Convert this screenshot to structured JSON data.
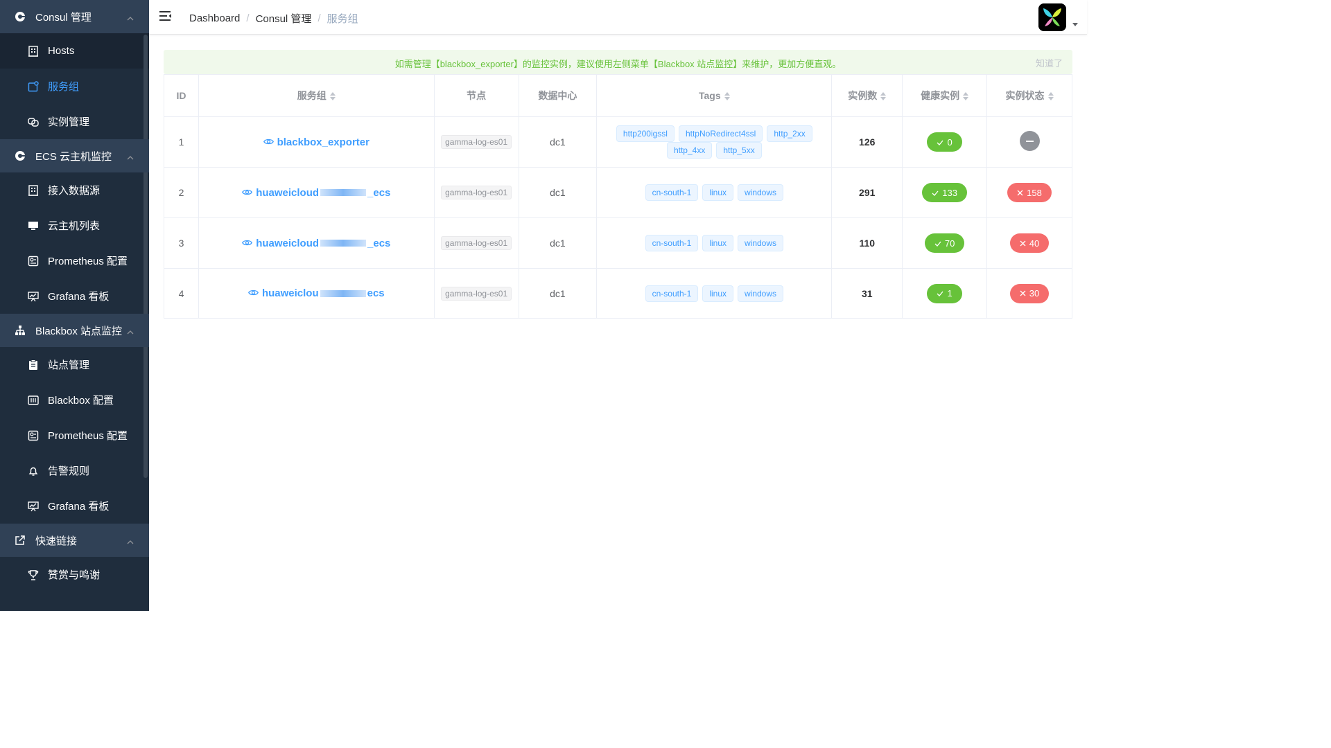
{
  "sidebar": {
    "groups": [
      {
        "title": "Consul 管理",
        "icon": "consul-icon",
        "items": [
          {
            "label": "Hosts",
            "icon": "building-icon",
            "active": false
          },
          {
            "label": "服务组",
            "icon": "service-group-icon",
            "active": true
          },
          {
            "label": "实例管理",
            "icon": "instance-icon",
            "active": false
          }
        ]
      },
      {
        "title": "ECS 云主机监控",
        "icon": "consul-icon",
        "items": [
          {
            "label": "接入数据源",
            "icon": "building-icon"
          },
          {
            "label": "云主机列表",
            "icon": "monitor-icon"
          },
          {
            "label": "Prometheus 配置",
            "icon": "config-icon"
          },
          {
            "label": "Grafana 看板",
            "icon": "dashboard-board-icon"
          }
        ]
      },
      {
        "title": "Blackbox 站点监控",
        "icon": "sitemap-icon",
        "items": [
          {
            "label": "站点管理",
            "icon": "clipboard-icon"
          },
          {
            "label": "Blackbox 配置",
            "icon": "blackbox-config-icon"
          },
          {
            "label": "Prometheus 配置",
            "icon": "config-icon"
          },
          {
            "label": "告警规则",
            "icon": "bell-icon"
          },
          {
            "label": "Grafana 看板",
            "icon": "dashboard-board-icon"
          }
        ]
      },
      {
        "title": "快速链接",
        "icon": "external-link-icon",
        "items": [
          {
            "label": "赞赏与鸣谢",
            "icon": "trophy-icon"
          }
        ]
      }
    ]
  },
  "breadcrumb": [
    "Dashboard",
    "Consul 管理",
    "服务组"
  ],
  "alert": {
    "text": "如需管理【blackbox_exporter】的监控实例，建议使用左侧菜单【Blackbox 站点监控】来维护，更加方便直观。",
    "close_label": "知道了"
  },
  "table": {
    "headers": {
      "id": "ID",
      "service": "服务组",
      "node": "节点",
      "dc": "数据中心",
      "tags": "Tags",
      "instances": "实例数",
      "healthy": "健康实例",
      "status": "实例状态"
    },
    "rows": [
      {
        "id": "1",
        "service_prefix": "blackbox_exporter",
        "service_suffix": "",
        "blurred": false,
        "node": "gamma-log-es01",
        "dc": "dc1",
        "tag_rows": [
          [
            "http200igssl",
            "httpNoRedirect4ssl",
            "http_2xx"
          ],
          [
            "http_4xx",
            "http_5xx"
          ]
        ],
        "instances": "126",
        "healthy": "0",
        "unhealthy": null
      },
      {
        "id": "2",
        "service_prefix": "huaweicloud",
        "service_suffix": "_ecs",
        "blurred": true,
        "node": "gamma-log-es01",
        "dc": "dc1",
        "tag_rows": [
          [
            "cn-south-1",
            "linux",
            "windows"
          ]
        ],
        "instances": "291",
        "healthy": "133",
        "unhealthy": "158"
      },
      {
        "id": "3",
        "service_prefix": "huaweicloud",
        "service_suffix": "_ecs",
        "blurred": true,
        "node": "gamma-log-es01",
        "dc": "dc1",
        "tag_rows": [
          [
            "cn-south-1",
            "linux",
            "windows"
          ]
        ],
        "instances": "110",
        "healthy": "70",
        "unhealthy": "40"
      },
      {
        "id": "4",
        "service_prefix": "huaweiclou",
        "service_suffix": "ecs",
        "blurred": true,
        "node": "gamma-log-es01",
        "dc": "dc1",
        "tag_rows": [
          [
            "cn-south-1",
            "linux",
            "windows"
          ]
        ],
        "instances": "31",
        "healthy": "1",
        "unhealthy": "30"
      }
    ]
  },
  "colors": {
    "sidebar_bg": "#1f2d3d",
    "group_bg": "#304156",
    "accent": "#409eff",
    "success": "#67c23a",
    "danger": "#f56c6c",
    "alert_bg": "#f0f9eb"
  }
}
